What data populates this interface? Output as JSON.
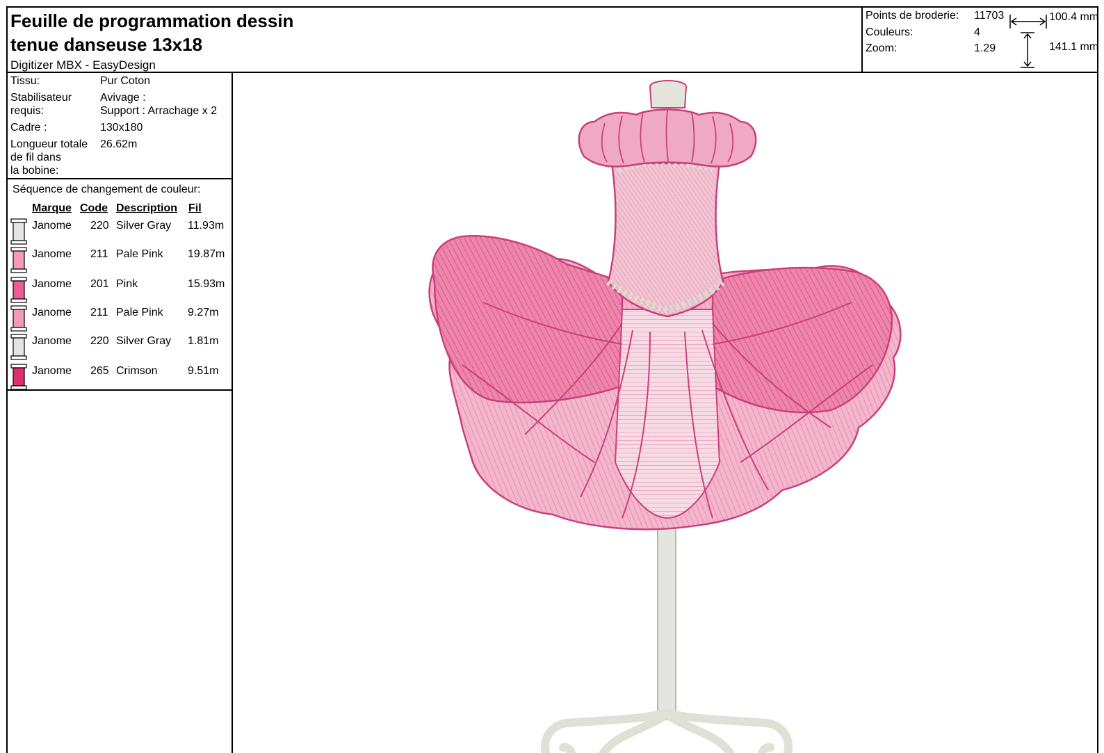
{
  "header": {
    "title_line1": "Feuille de programmation dessin",
    "title_line2": "tenue danseuse 13x18",
    "subtitle": "Digitizer MBX - EasyDesign"
  },
  "stats": {
    "stitches_label": "Points de broderie:",
    "stitches_value": "11703",
    "colors_label": "Couleurs:",
    "colors_value": "4",
    "zoom_label": "Zoom:",
    "zoom_value": "1.29",
    "width": "100.4 mm",
    "height": "141.1 mm"
  },
  "fabric": {
    "tissu_label": "Tissu:",
    "tissu_value": "Pur Coton",
    "stab_label_1": "Stabilisateur",
    "stab_label_2": "requis:",
    "stab_value_1": "Avivage :",
    "stab_value_2": "Support : Arrachage x 2",
    "cadre_label": "Cadre :",
    "cadre_value": "130x180",
    "length_label_1": "Longueur totale",
    "length_label_2": "de fil dans",
    "length_label_3": "la bobine:",
    "length_value": "26.62m"
  },
  "sequence": {
    "title": "Séquence de changement de couleur:",
    "headers": {
      "brand": "Marque",
      "code": "Code",
      "desc": "Description",
      "len": "Fil"
    },
    "threads": [
      {
        "brand": "Janome",
        "code": "220",
        "desc": "Silver Gray",
        "len": "11.93m",
        "color": "#e4e4e0"
      },
      {
        "brand": "Janome",
        "code": "211",
        "desc": "Pale Pink",
        "len": "19.87m",
        "color": "#f49ab8"
      },
      {
        "brand": "Janome",
        "code": "201",
        "desc": "Pink",
        "len": "15.93m",
        "color": "#ec5d93"
      },
      {
        "brand": "Janome",
        "code": "211",
        "desc": "Pale Pink",
        "len": "9.27m",
        "color": "#f49ab8"
      },
      {
        "brand": "Janome",
        "code": "220",
        "desc": "Silver Gray",
        "len": "1.81m",
        "color": "#e4e4e0"
      },
      {
        "brand": "Janome",
        "code": "265",
        "desc": "Crimson",
        "len": "9.51m",
        "color": "#dc2f70"
      }
    ]
  }
}
